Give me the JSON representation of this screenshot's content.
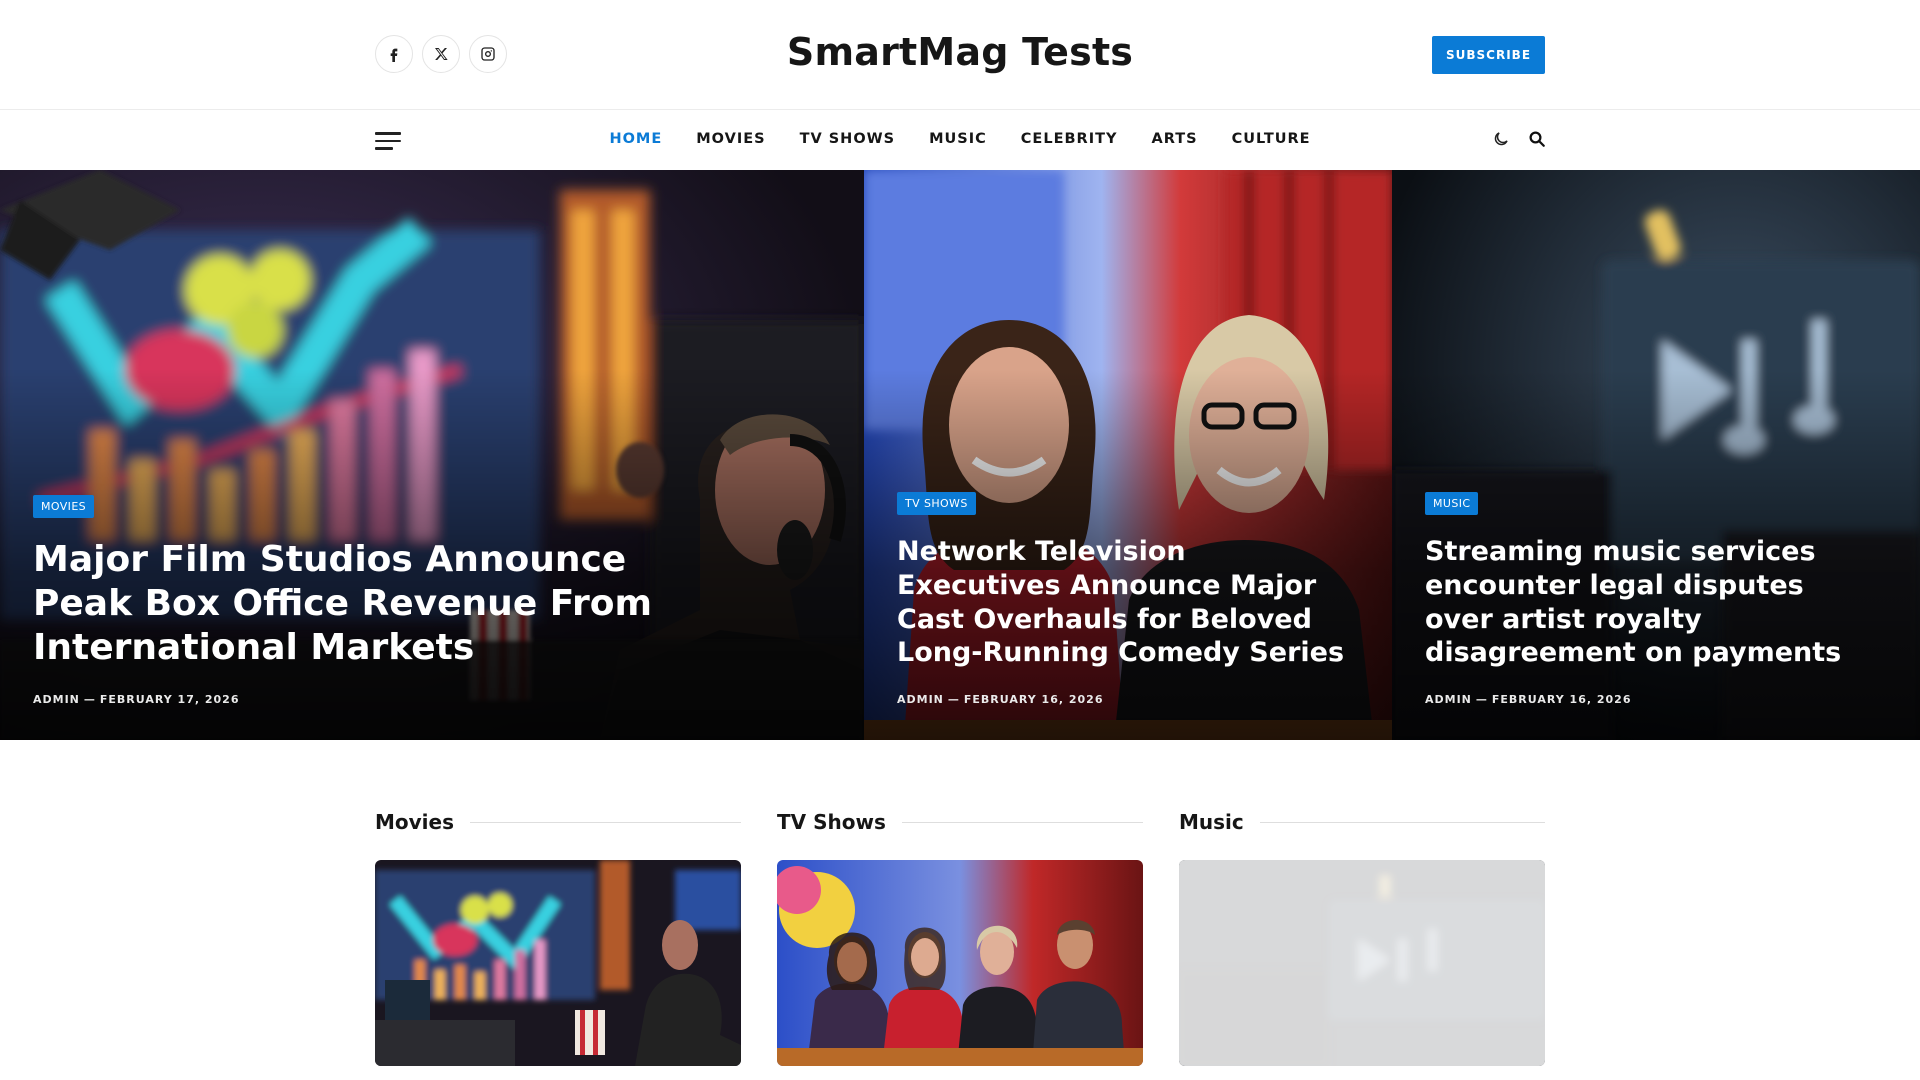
{
  "header": {
    "site_title": "SmartMag Tests",
    "subscribe_label": "SUBSCRIBE",
    "social": [
      {
        "icon": "facebook-icon"
      },
      {
        "icon": "x-twitter-icon"
      },
      {
        "icon": "instagram-icon"
      }
    ]
  },
  "nav": {
    "items": [
      "HOME",
      "MOVIES",
      "TV SHOWS",
      "MUSIC",
      "CELEBRITY",
      "ARTS",
      "CULTURE"
    ],
    "active": "HOME",
    "icons": [
      "dark-mode-moon-icon",
      "search-icon"
    ]
  },
  "hero": [
    {
      "category": "MOVIES",
      "title": "Major Film Studios Announce Peak Box Office Revenue From International Markets",
      "author": "ADMIN",
      "date": "FEBRUARY 17, 2026"
    },
    {
      "category": "TV SHOWS",
      "title": "Network Television Executives Announce Major Cast Overhauls for Beloved Long-Running Comedy Series",
      "author": "ADMIN",
      "date": "FEBRUARY 16, 2026"
    },
    {
      "category": "MUSIC",
      "title": "Streaming music services encounter legal disputes over artist royalty disagreement on payments",
      "author": "ADMIN",
      "date": "FEBRUARY 16, 2026"
    }
  ],
  "sections": [
    {
      "title": "Movies"
    },
    {
      "title": "TV Shows"
    },
    {
      "title": "Music"
    }
  ],
  "colors": {
    "accent": "#0b7bd6",
    "text": "#161616"
  },
  "meta_separator": "—"
}
